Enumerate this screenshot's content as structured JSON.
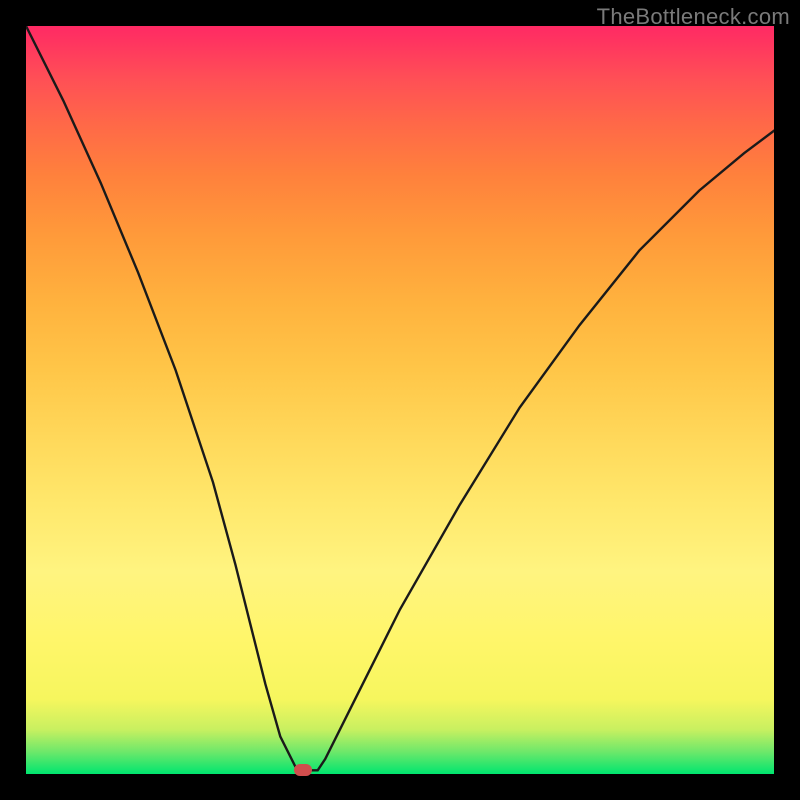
{
  "watermark": "TheBottleneck.com",
  "chart_data": {
    "type": "line",
    "title": "",
    "xlabel": "",
    "ylabel": "",
    "xlim": [
      0,
      100
    ],
    "ylim": [
      0,
      100
    ],
    "grid": false,
    "series": [
      {
        "name": "bottleneck-curve",
        "x": [
          0,
          5,
          10,
          15,
          20,
          25,
          28,
          30,
          32,
          34,
          36,
          37,
          38,
          39,
          40,
          44,
          50,
          58,
          66,
          74,
          82,
          90,
          96,
          100
        ],
        "values": [
          100,
          90,
          79,
          67,
          54,
          39,
          28,
          20,
          12,
          5,
          1,
          0.5,
          0.5,
          0.5,
          2,
          10,
          22,
          36,
          49,
          60,
          70,
          78,
          83,
          86
        ]
      }
    ],
    "marker": {
      "x": 37,
      "y": 0.5,
      "name": "optimal-point"
    },
    "background_gradient": {
      "0": "#00e56f",
      "50": "#ffe14a",
      "100": "#ff2a64"
    }
  }
}
